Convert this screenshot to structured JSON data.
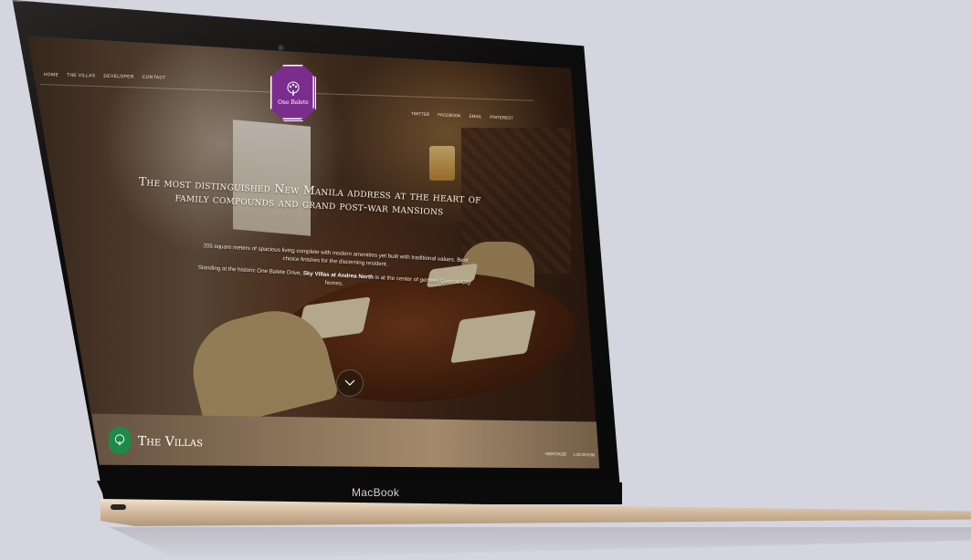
{
  "device": {
    "brand_label": "MacBook"
  },
  "site": {
    "nav": [
      "HOME",
      "THE VILLAS",
      "DEVELOPER",
      "CONTACT"
    ],
    "social": [
      "TWITTER",
      "FACEBOOK",
      "EMAIL",
      "PINTEREST"
    ],
    "logo_text": "One Balete",
    "hero": {
      "title": "The most distinguished New Manila address at the heart of family compounds and grand post-war mansions",
      "paragraph1": "205 square meters of spacious living complete with modern amenities yet built with traditional values. Best choice finishes for the discerning resident.",
      "paragraph2_prefix": "Standing at the historic One Balete Drive,",
      "paragraph2_bold": "Sky Villas at Andrea North",
      "paragraph2_suffix": "is at the center of genteel Quezon City homes."
    },
    "footer": {
      "section_title": "The Villas",
      "links": [
        "HERITAGE",
        "LOCATION"
      ]
    }
  },
  "colors": {
    "logo_purple": "#7b2d8e",
    "villas_green": "#1e8a4a"
  },
  "icons": {
    "scroll_down": "chevron-down-icon"
  }
}
